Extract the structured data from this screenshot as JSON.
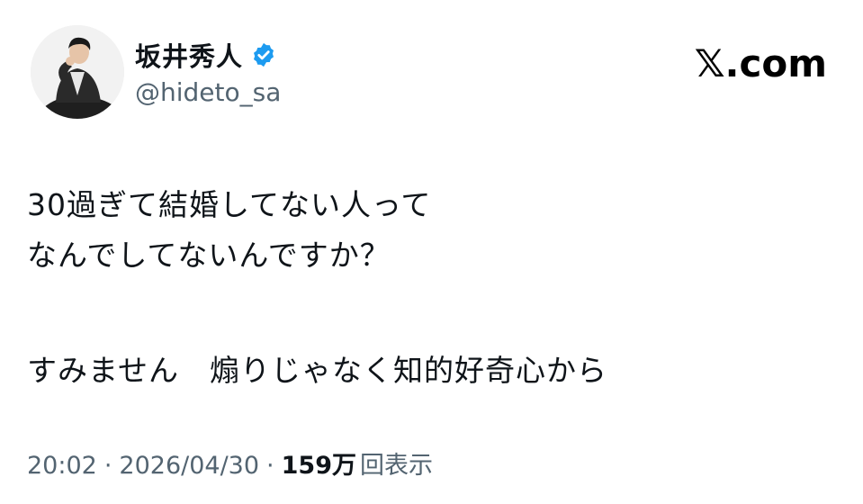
{
  "author": {
    "display_name": "坂井秀人",
    "handle": "@hideto_sa",
    "verified_icon": "verified-badge-icon",
    "verified_color": "#1d9bf0"
  },
  "brand": {
    "label": "𝕏.com"
  },
  "tweet": {
    "lines": [
      "30過ぎて結婚してない人って",
      "なんでしてないんですか？",
      "すみません　煽りじゃなく知的好奇心から"
    ]
  },
  "meta": {
    "time": "20:02",
    "separator": "·",
    "date": "2026/04/30",
    "views_count": "159万",
    "views_label": "回表示"
  }
}
